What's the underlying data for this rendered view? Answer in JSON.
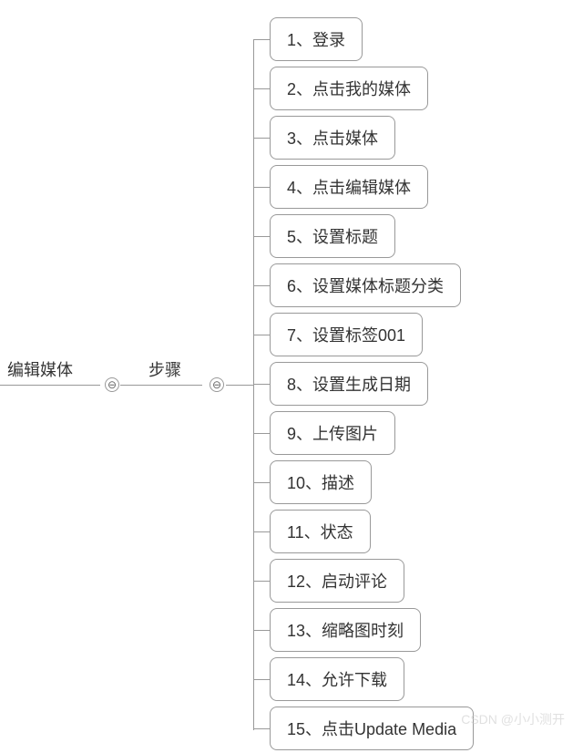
{
  "root": {
    "label": "编辑媒体"
  },
  "mid": {
    "label": "步骤"
  },
  "collapse_symbol": "⊖",
  "leaves": [
    {
      "label": "1、登录"
    },
    {
      "label": "2、点击我的媒体"
    },
    {
      "label": "3、点击媒体"
    },
    {
      "label": "4、点击编辑媒体"
    },
    {
      "label": "5、设置标题"
    },
    {
      "label": "6、设置媒体标题分类"
    },
    {
      "label": "7、设置标签001"
    },
    {
      "label": "8、设置生成日期"
    },
    {
      "label": "9、上传图片"
    },
    {
      "label": "10、描述"
    },
    {
      "label": "11、状态"
    },
    {
      "label": "12、启动评论"
    },
    {
      "label": "13、缩略图时刻"
    },
    {
      "label": "14、允许下载"
    },
    {
      "label": "15、点击Update Media"
    }
  ],
  "watermark": "CSDN @小小测开"
}
